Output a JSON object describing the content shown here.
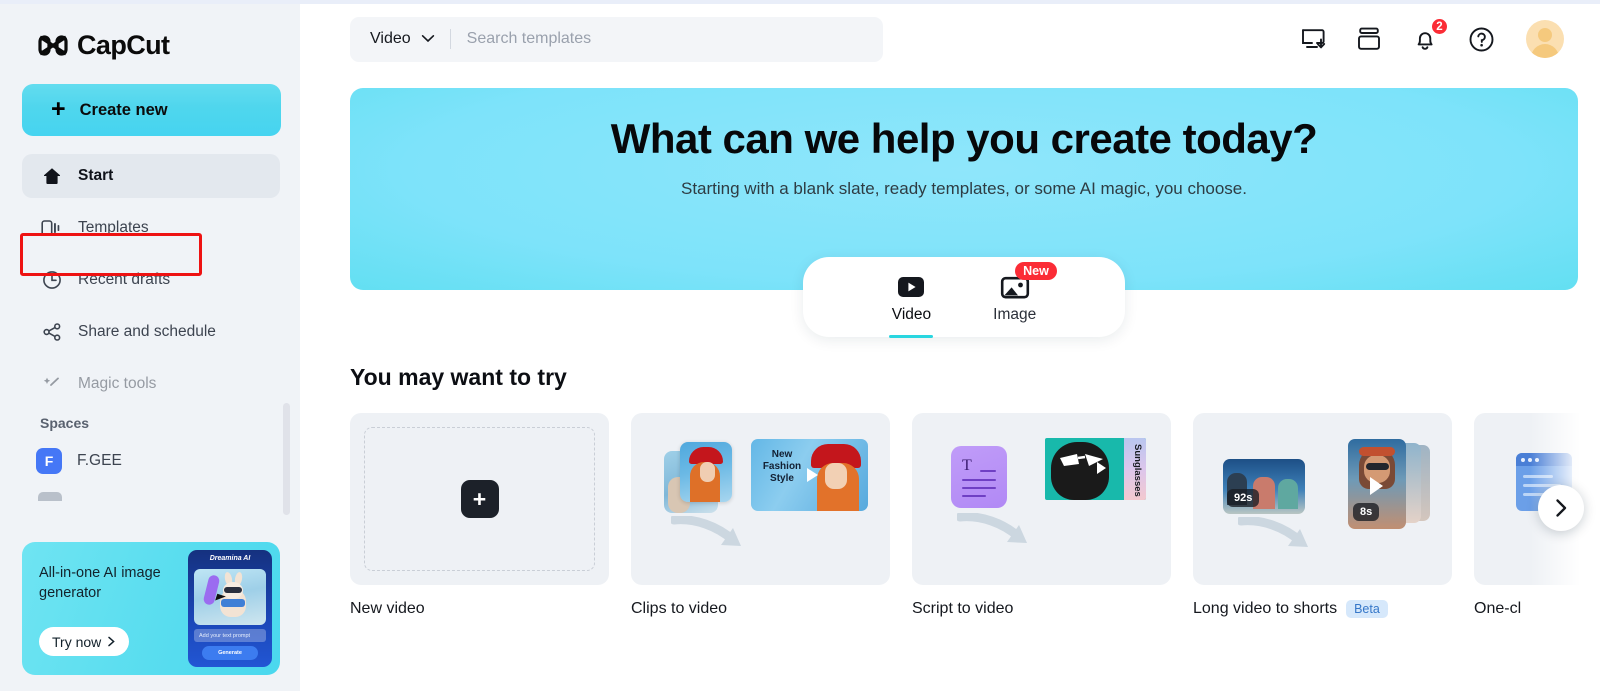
{
  "app": {
    "name": "CapCut"
  },
  "sidebar": {
    "logo_text": "CapCut",
    "create_button": {
      "label": "Create new",
      "icon": "plus-icon"
    },
    "nav_items": [
      {
        "label": "Start",
        "icon": "home-icon",
        "active": true
      },
      {
        "label": "Templates",
        "icon": "templates-icon",
        "active": false
      },
      {
        "label": "Recent drafts",
        "icon": "clock-icon",
        "active": false
      },
      {
        "label": "Share and schedule",
        "icon": "share-icon",
        "active": false
      },
      {
        "label": "Magic tools",
        "icon": "magic-wand-icon",
        "active": false
      }
    ],
    "spaces": {
      "heading": "Spaces",
      "items": [
        {
          "label": "F.GEE",
          "initial": "F",
          "color": "#4577f6"
        }
      ]
    },
    "promo": {
      "title": "All-in-one AI image generator",
      "button_label": "Try now",
      "brand": "Dreamina AI",
      "input_placeholder": "Add your text prompt",
      "generate_label": "Generate"
    }
  },
  "topbar": {
    "search": {
      "filter_value": "Video",
      "placeholder": "Search templates",
      "value": ""
    },
    "icons": [
      {
        "name": "download-app-icon"
      },
      {
        "name": "archive-box-icon"
      },
      {
        "name": "notifications-bell-icon",
        "badge": "2"
      },
      {
        "name": "help-circle-icon"
      }
    ],
    "avatar": {
      "name": "user-avatar"
    }
  },
  "hero": {
    "title": "What can we help you create today?",
    "subtitle": "Starting with a blank slate, ready templates, or some AI magic, you choose.",
    "gradient_start": "#8FE6FB",
    "gradient_end": "#2ED6DE"
  },
  "mode_toggle": {
    "options": [
      {
        "label": "Video",
        "icon": "video-play-icon",
        "selected": true,
        "badge": ""
      },
      {
        "label": "Image",
        "icon": "image-icon",
        "selected": false,
        "badge": "New"
      }
    ]
  },
  "try_section": {
    "title": "You may want to try",
    "cards": [
      {
        "label": "New video",
        "badge": "",
        "thumb": "new-video"
      },
      {
        "label": "Clips to video",
        "badge": "",
        "thumb": "clips-to-video",
        "overlay_text": "New Fashion Style"
      },
      {
        "label": "Script to video",
        "badge": "",
        "thumb": "script-to-video",
        "overlay_text": "Sunglasses"
      },
      {
        "label": "Long video to shorts",
        "badge": "Beta",
        "thumb": "long-to-shorts",
        "duration_in": "92s",
        "duration_out": "8s"
      },
      {
        "label": "One-cl",
        "badge": "",
        "thumb": "one-click"
      }
    ],
    "next_label": "›"
  },
  "annotation": {
    "target": "Templates",
    "color": "#ee1212"
  }
}
